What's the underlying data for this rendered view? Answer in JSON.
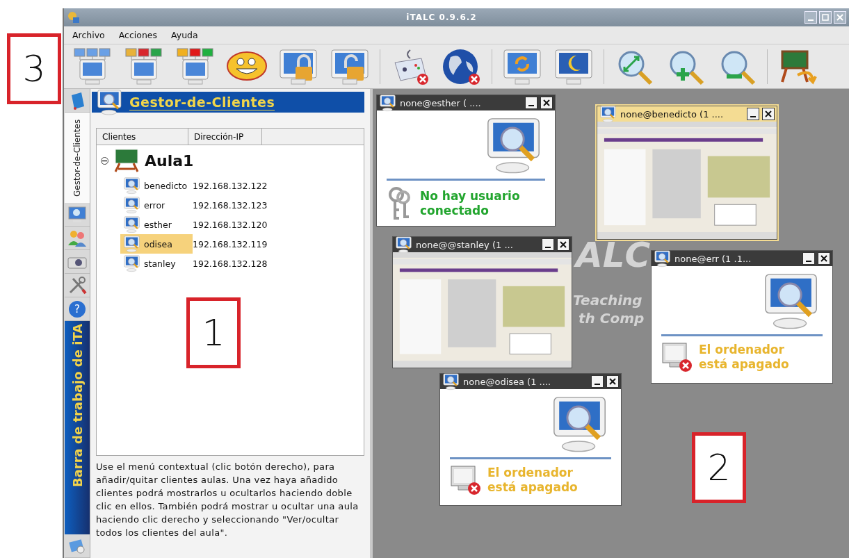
{
  "window": {
    "title": "iTALC 0.9.6.2"
  },
  "menu": [
    "Archivo",
    "Acciones",
    "Ayuda"
  ],
  "sidebar": {
    "tabs": [
      {
        "label": "Gestor-de-Clientes",
        "selected": true
      }
    ],
    "bar_title": "Barra de trabajo de iTA",
    "help_glyph": "?"
  },
  "panel": {
    "title": "Gestor-de-Clientes",
    "columns": [
      "Clientes",
      "Dirección-IP"
    ],
    "groups": [
      {
        "name": "Aula1",
        "expanded": true,
        "children": [
          {
            "name": "benedicto",
            "ip": "192.168.132.122",
            "selected": false
          },
          {
            "name": "error",
            "ip": "192.168.132.123",
            "selected": false
          },
          {
            "name": "esther",
            "ip": "192.168.132.120",
            "selected": false
          },
          {
            "name": "odisea",
            "ip": "192.168.132.119",
            "selected": true
          },
          {
            "name": "stanley",
            "ip": "192.168.132.128",
            "selected": false
          }
        ]
      }
    ],
    "help": "Use el menú contextual (clic botón derecho), para añadir/quitar clientes aulas. Una vez haya añadido clientes podrá mostrarlos u ocultarlos haciendo doble clic en ellos. También podrá mostrar u ocultar una aula haciendo clic derecho y seleccionando \"Ver/ocultar todos los clientes del aula\"."
  },
  "background_logo": [
    "ALC",
    "Teaching",
    "th Comp"
  ],
  "client_windows": [
    {
      "title": "none@esther ( ....",
      "kind": "no_user",
      "message": "No hay usuario conectado",
      "selected": false
    },
    {
      "title": "none@benedicto (1 ....",
      "kind": "screen",
      "selected": true
    },
    {
      "title": "none@@stanley (1 ...",
      "kind": "screen",
      "selected": false
    },
    {
      "title": "none@err (1 .1...",
      "kind": "off",
      "message": "El ordenador está apagado",
      "selected": false
    },
    {
      "title": "none@odisea (1 ....",
      "kind": "off",
      "message": "El ordenador está apagado",
      "selected": false
    }
  ],
  "callouts": [
    {
      "label": "3"
    },
    {
      "label": "1"
    },
    {
      "label": "2"
    }
  ]
}
